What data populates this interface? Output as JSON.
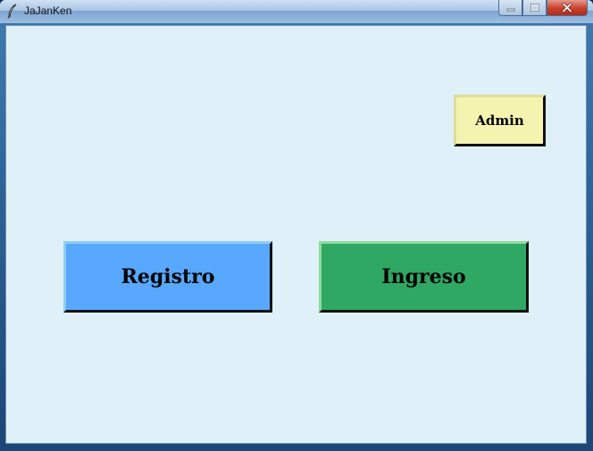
{
  "window": {
    "title": "JaJanKen",
    "icon": "feather-icon",
    "controls": {
      "minimize": "minimize-icon",
      "maximize": "maximize-icon",
      "close": "close-icon"
    }
  },
  "main": {
    "background_color": "#e0f0f8",
    "buttons": {
      "admin": {
        "label": "Admin",
        "color": "#f5f3b0"
      },
      "registro": {
        "label": "Registro",
        "color": "#58a8ff"
      },
      "ingreso": {
        "label": "Ingreso",
        "color": "#2ea863"
      }
    }
  }
}
